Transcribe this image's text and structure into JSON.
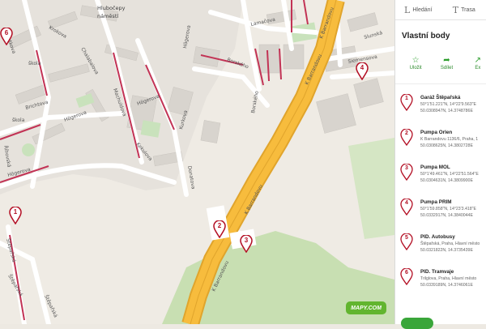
{
  "map": {
    "streets": {
      "lamacova": "Lamačova",
      "borskeho": "Borského",
      "borskeho_b": "Borského",
      "k_barrandovu_1": "K Barrandovu",
      "k_barrandovu_2": "K Barrandovu",
      "k_barrandovu_3": "K Barrandovu",
      "k_barrandovu_4": "K Barrandovu",
      "hogerova_1": "Högerova",
      "hogerova_2": "Högerova",
      "hogerova_3": "Högerova",
      "hogerova_4": "Högerova",
      "krokova": "Krokova",
      "krtkova": "Krtkova",
      "brichtova": "Brichtova",
      "machuldova": "Machuldova",
      "kurkova": "Kurkova",
      "kekulova": "Kekulova",
      "donatova": "Donatova",
      "stepanska_1": "Štěpařská",
      "stepanska_2": "Štěpařská",
      "stepanska_3": "Štěpařská",
      "slunska": "Slunská",
      "siemensova": "Siemensova",
      "rihovska": "Říhovská",
      "chalabalova": "Chalabalova"
    },
    "labels": {
      "hlubocepy": "Hlubočepy",
      "namesti": "náměstí",
      "skola": "škola",
      "skola2": "škola"
    },
    "markers": [
      "1",
      "2",
      "3",
      "4",
      "6"
    ],
    "logo": "MAPY.COM"
  },
  "panel": {
    "tabs": [
      {
        "glyph": "L",
        "label": "Hledání"
      },
      {
        "glyph": "T",
        "label": "Trasa"
      }
    ],
    "title": "Vlastní body",
    "actions": [
      {
        "icon": "star-icon",
        "glyph": "☆",
        "label": "Uložit"
      },
      {
        "icon": "share-icon",
        "glyph": "➦",
        "label": "Sdílet"
      },
      {
        "icon": "export-icon",
        "glyph": "↗",
        "label": "Ex"
      }
    ],
    "pois": [
      {
        "num": "1",
        "name": "Garáž Štěpařská",
        "line1": "50°1'51.221\"N, 14°22'9.563\"E",
        "line2": "50.0308947N, 14.3748786E"
      },
      {
        "num": "2",
        "name": "Pumpa Orlen",
        "line1": "K Barrandovu 1136/6, Praha, 1",
        "line2": "50.0308625N, 14.3802728E"
      },
      {
        "num": "3",
        "name": "Pumpa MOL",
        "line1": "50°1'49.461\"N, 14°22'51.564\"E",
        "line2": "50.0304631N, 14.3809900E"
      },
      {
        "num": "4",
        "name": "Pumpa PRIM",
        "line1": "50°1'59.858\"N, 14°23'3.418\"E",
        "line2": "50.0332917N, 14.3840044E"
      },
      {
        "num": "5",
        "name": "PID. Autobusy",
        "line1": "Štěpařská, Praha, Hlavní město",
        "line2": "50.0321822N, 14.3735439E"
      },
      {
        "num": "6",
        "name": "PID. Tramvaje",
        "line1": "Trilglova, Praha, Hlavní město",
        "line2": "50.0339189N, 14.3746061E"
      }
    ]
  }
}
